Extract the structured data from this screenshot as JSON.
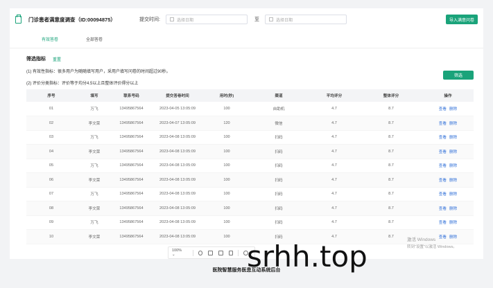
{
  "header": {
    "title": "门诊患者满意度调查（ID:00094875）",
    "submit_time_label": "提交时间:",
    "start_placeholder": "选择日期",
    "to_label": "至",
    "end_placeholder": "选择日期",
    "export_label": "导入满意问卷"
  },
  "tabs": [
    {
      "label": "有效答卷",
      "active": true
    },
    {
      "label": "全部答卷",
      "active": false
    }
  ],
  "filter": {
    "title": "筛选指标",
    "setting": "重置",
    "note1": "(1) 有效性指标：很多用户为随随填写用户，采用户填写问卷的时间超过90秒。",
    "note2": "(2) 评价分类指标：评价等于均分4.5以上且整体评价得分以上",
    "filter_button": "筛选"
  },
  "table": {
    "headers": [
      "序号",
      "填写",
      "联系号码",
      "提交答卷时间",
      "用时(秒)",
      "渠道",
      "平均评分",
      "整体评分",
      "操作"
    ],
    "rows": [
      [
        "01",
        "万飞",
        "13495867564",
        "2023-04-05  13:05:09",
        "100",
        "自助机",
        "4.7",
        "8.7"
      ],
      [
        "02",
        "李文荣",
        "13495867564",
        "2023-04-07  13:05:09",
        "120",
        "微信",
        "4.7",
        "8.7"
      ],
      [
        "03",
        "万飞",
        "13495867564",
        "2023-04-08  13:05:09",
        "100",
        "扫码",
        "4.7",
        "8.7"
      ],
      [
        "04",
        "李文荣",
        "13495867564",
        "2023-04-08  13:05:09",
        "100",
        "扫码",
        "4.7",
        "8.7"
      ],
      [
        "05",
        "万飞",
        "13495867564",
        "2023-04-08  13:05:09",
        "100",
        "扫码",
        "4.7",
        "8.7"
      ],
      [
        "06",
        "李文荣",
        "13495867564",
        "2023-04-08  13:05:09",
        "100",
        "扫码",
        "4.7",
        "8.7"
      ],
      [
        "07",
        "万飞",
        "13495867564",
        "2023-04-08  13:05:09",
        "100",
        "扫码",
        "4.7",
        "8.7"
      ],
      [
        "08",
        "李文荣",
        "13495867564",
        "2023-04-08  13:05:09",
        "100",
        "扫码",
        "4.7",
        "8.7"
      ],
      [
        "09",
        "万飞",
        "13495867564",
        "2023-04-08  13:05:09",
        "100",
        "扫码",
        "4.7",
        "8.7"
      ],
      [
        "10",
        "李文荣",
        "13495867564",
        "2023-04-08  13:05:09",
        "100",
        "扫码",
        "4.7",
        "8.7"
      ]
    ],
    "op_view": "查看",
    "op_delete": "删除"
  },
  "toolbar": {
    "zoom": "100% ⌄"
  },
  "watermark": {
    "line1": "激活 Windows",
    "line2": "转到\"设置\"以激活 Windows。"
  },
  "overlay_url": "srhh.top",
  "caption": "医院智慧服务医患互动系统后台",
  "colors": {
    "accent": "#1aa37a",
    "link": "#2f6fd8"
  }
}
